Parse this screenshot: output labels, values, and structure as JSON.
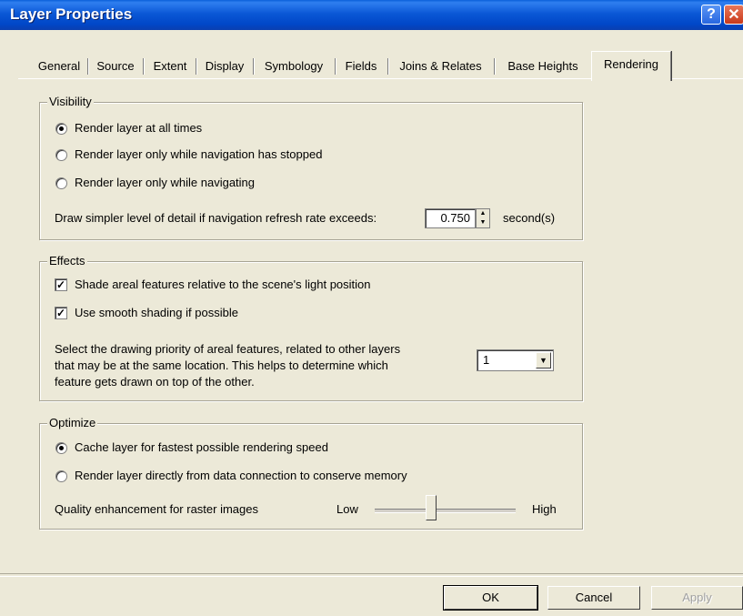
{
  "window": {
    "title": "Layer Properties",
    "help_label": "?",
    "close_label": "✕"
  },
  "tabs": [
    "General",
    "Source",
    "Extent",
    "Display",
    "Symbology",
    "Fields",
    "Joins & Relates",
    "Base Heights",
    "Rendering"
  ],
  "active_tab": "Rendering",
  "visibility": {
    "legend": "Visibility",
    "options": [
      {
        "label": "Render layer at all times",
        "checked": true
      },
      {
        "label": "Render layer only while navigation has stopped",
        "checked": false
      },
      {
        "label": "Render layer only while navigating",
        "checked": false
      }
    ],
    "refresh_label": "Draw simpler level of detail if navigation refresh rate exceeds:",
    "refresh_value": "0.750",
    "refresh_unit": "second(s)"
  },
  "effects": {
    "legend": "Effects",
    "checks": [
      {
        "label": "Shade areal features relative to the scene's light position",
        "checked": true
      },
      {
        "label": "Use smooth shading if possible",
        "checked": true
      }
    ],
    "priority_lines": [
      "Select the drawing priority of areal features, related to other layers",
      "that may be at the same location.  This helps to determine which",
      "feature gets drawn on top of the other."
    ],
    "priority_value": "1"
  },
  "optimize": {
    "legend": "Optimize",
    "options": [
      {
        "label": "Cache layer for fastest possible rendering speed",
        "checked": true
      },
      {
        "label": "Render layer directly from data connection to conserve memory",
        "checked": false
      }
    ],
    "quality_label": "Quality enhancement for raster images",
    "low_label": "Low",
    "high_label": "High",
    "slider_level": 0.4
  },
  "buttons": {
    "ok": "OK",
    "cancel": "Cancel",
    "apply": "Apply"
  }
}
